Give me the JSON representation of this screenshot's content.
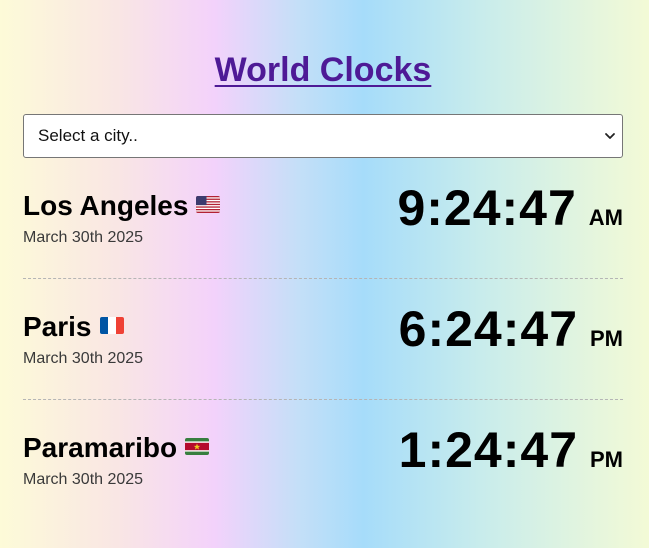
{
  "header": {
    "title": "World Clocks"
  },
  "city_select": {
    "selected": "Select a city.."
  },
  "clocks": [
    {
      "city": "Los Angeles",
      "flag": "us-flag",
      "date": "March 30th 2025",
      "time": "9:24:47",
      "ampm": "AM"
    },
    {
      "city": "Paris",
      "flag": "fr-flag",
      "date": "March 30th 2025",
      "time": "6:24:47",
      "ampm": "PM"
    },
    {
      "city": "Paramaribo",
      "flag": "sr-flag",
      "date": "March 30th 2025",
      "time": "1:24:47",
      "ampm": "PM"
    }
  ],
  "colors": {
    "title": "#4e1a96",
    "divider": "#b5b5b5"
  }
}
